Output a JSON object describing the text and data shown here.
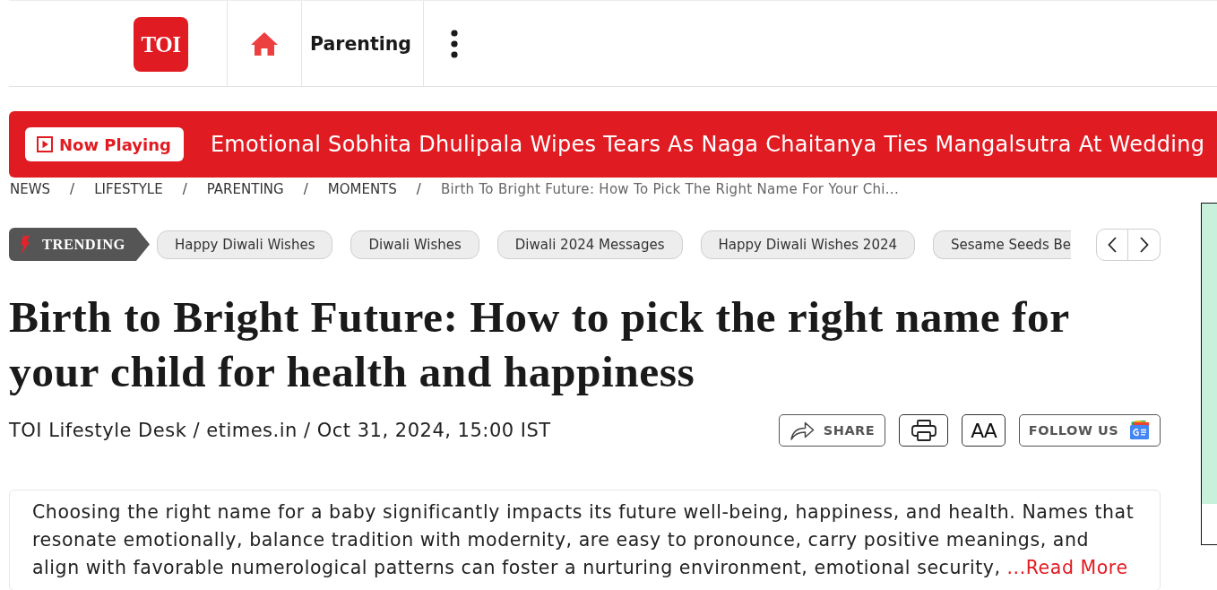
{
  "header": {
    "logo": "TOI",
    "section": "Parenting"
  },
  "now_playing": {
    "label": "Now Playing",
    "headline": "Emotional Sobhita Dhulipala Wipes Tears As Naga Chaitanya Ties Mangalsutra At Wedding"
  },
  "breadcrumb": {
    "separator": "/",
    "items": [
      {
        "label": "NEWS",
        "kind": "link"
      },
      {
        "label": "LIFESTYLE",
        "kind": "link"
      },
      {
        "label": "PARENTING",
        "kind": "link"
      },
      {
        "label": "MOMENTS",
        "kind": "link"
      },
      {
        "label": "Birth To Bright Future: How To Pick The Right Name For Your Chi...",
        "kind": "current"
      }
    ]
  },
  "trending": {
    "label": "TRENDING",
    "tags": [
      "Happy Diwali Wishes",
      "Diwali Wishes",
      "Diwali 2024 Messages",
      "Happy Diwali Wishes 2024",
      "Sesame Seeds Be"
    ]
  },
  "article": {
    "title": "Birth to Bright Future: How to pick the right name for your child for health and happiness",
    "byline": "TOI Lifestyle Desk / etimes.in / Oct 31, 2024, 15:00 IST",
    "actions": [
      {
        "kind": "share",
        "label": "SHARE"
      },
      {
        "kind": "print"
      },
      {
        "kind": "font_size",
        "label": "AA"
      },
      {
        "kind": "follow",
        "label": "FOLLOW US"
      }
    ],
    "summary": "Choosing the right name for a baby significantly impacts its future well-being, happiness, and health. Names that resonate emotionally, balance tradition with modernity, are easy to pronounce, carry positive meanings, and align with favorable numerological patterns can foster a nurturing environment, emotional security,",
    "read_more": "...Read More"
  }
}
